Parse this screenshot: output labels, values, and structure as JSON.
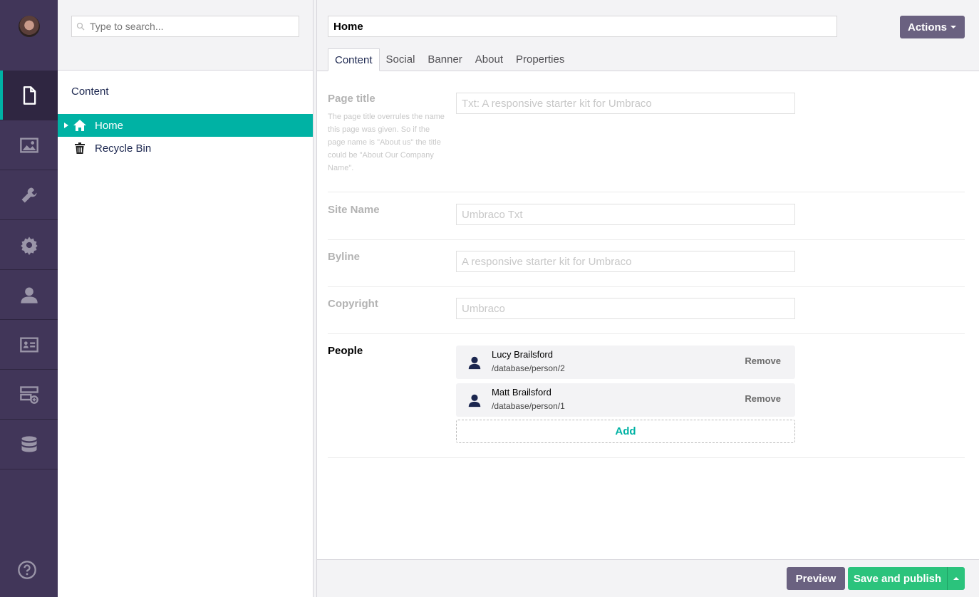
{
  "rail": {
    "items": [
      {
        "name": "content",
        "icon": "document-icon"
      },
      {
        "name": "media",
        "icon": "image-icon"
      },
      {
        "name": "settings",
        "icon": "wrench-icon"
      },
      {
        "name": "developer",
        "icon": "gear-icon"
      },
      {
        "name": "users",
        "icon": "user-icon"
      },
      {
        "name": "members",
        "icon": "id-card-icon"
      },
      {
        "name": "forms",
        "icon": "form-add-icon"
      },
      {
        "name": "database",
        "icon": "database-icon"
      }
    ],
    "help_icon": "help-icon"
  },
  "tree": {
    "search_placeholder": "Type to search...",
    "title": "Content",
    "nodes": [
      {
        "label": "Home",
        "icon": "home-icon",
        "selected": true
      },
      {
        "label": "Recycle Bin",
        "icon": "trash-icon",
        "selected": false
      }
    ]
  },
  "editor": {
    "name_value": "Home",
    "actions_label": "Actions",
    "tabs": [
      "Content",
      "Social",
      "Banner",
      "About",
      "Properties"
    ],
    "properties": {
      "page_title": {
        "label": "Page title",
        "description": "The page title overrules the name this page was given. So if the page name is \"About us\" the title could be \"About Our Company Name\".",
        "placeholder": "Txt: A responsive starter kit for Umbraco"
      },
      "site_name": {
        "label": "Site Name",
        "placeholder": "Umbraco Txt"
      },
      "byline": {
        "label": "Byline",
        "placeholder": "A responsive starter kit for Umbraco"
      },
      "copyright": {
        "label": "Copyright",
        "placeholder": "Umbraco"
      }
    },
    "people": {
      "label": "People",
      "items": [
        {
          "name": "Lucy Brailsford",
          "path": "/database/person/2",
          "remove_label": "Remove"
        },
        {
          "name": "Matt Brailsford",
          "path": "/database/person/1",
          "remove_label": "Remove"
        }
      ],
      "add_label": "Add"
    }
  },
  "footer": {
    "preview_label": "Preview",
    "publish_label": "Save and publish"
  },
  "colors": {
    "rail": "#413659",
    "accent": "#00b2a4",
    "secondary_button": "#6a6180",
    "publish": "#2bc37c"
  }
}
